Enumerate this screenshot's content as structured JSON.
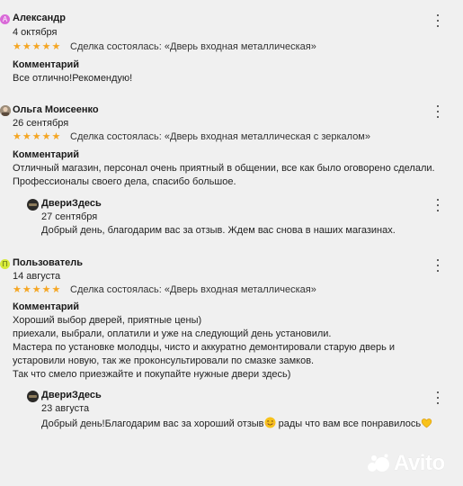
{
  "colors": {
    "star": "#f5a623",
    "avatar_a": "#d96ad8",
    "avatar_p": "#d6ea3a",
    "background": "#f0f0f0"
  },
  "reviews": [
    {
      "avatar_letter": "А",
      "name": "Александр",
      "date": "4 октября",
      "rating": 5,
      "deal": "Сделка состоялась: «Дверь входная металлическая»",
      "comment_title": "Комментарий",
      "comment_lines": [
        "Все отлично!Рекомендую!"
      ]
    },
    {
      "avatar_letter": "",
      "name": "Ольга Моисеенко",
      "date": "26 сентября",
      "rating": 5,
      "deal": "Сделка состоялась: «Дверь входная металлическая с зеркалом»",
      "comment_title": "Комментарий",
      "comment_lines": [
        "Отличный магазин, персонал очень приятный в общении, все как было оговорено сделали.",
        "Профессионалы своего дела, спасибо большое."
      ],
      "reply": {
        "name": "ДвериЗдесь",
        "date": "27 сентября",
        "text": "Добрый день, благодарим вас за отзыв. Ждем вас снова в наших магазинах."
      }
    },
    {
      "avatar_letter": "П",
      "name": "Пользователь",
      "date": "14 августа",
      "rating": 5,
      "deal": "Сделка состоялась: «Дверь входная металлическая»",
      "comment_title": "Комментарий",
      "comment_lines": [
        "Хороший выбор дверей, приятные цены)",
        "приехали, выбрали, оплатили и уже на следующий день установили.",
        "Мастера по установке молодцы, чисто и аккуратно демонтировали старую дверь и",
        "устаровили новую, так же проконсультировали по смазке замков.",
        "Так что смело приезжайте и покупайте нужные двери здесь)"
      ],
      "reply": {
        "name": "ДвериЗдесь",
        "date": "23 августа",
        "text_before": "Добрый день!Благодарим вас за хороший отзыв",
        "text_middle": " рады что вам все понравилось",
        "emoji_1": "smiling-face-icon",
        "emoji_2": "yellow-heart-icon"
      }
    }
  ],
  "watermark": {
    "text": "Avito",
    "icon": "avito-logo-icon"
  }
}
